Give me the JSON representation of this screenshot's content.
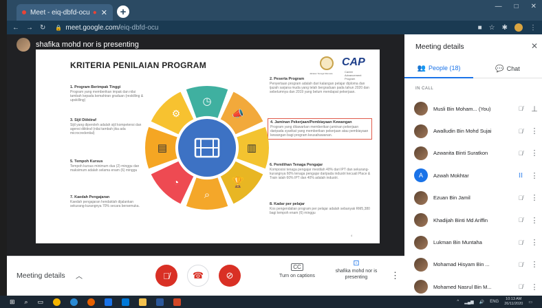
{
  "browser": {
    "tab_title": "Meet - eiq-dbfd-ocu",
    "url_host": "meet.google.com/",
    "url_path": "eiq-dbfd-ocu",
    "new_tab_icon": "+",
    "window_controls": [
      "—",
      "□",
      "✕"
    ]
  },
  "presenter": {
    "text": "shafika mohd nor is presenting"
  },
  "slide": {
    "title": "KRITERIA PENILAIAN PROGRAM",
    "logo_text": "Jabatan Tenaga Manusia",
    "logo2_text": "CAP",
    "logo2_sub": "Career Advancement Program",
    "left_items": [
      {
        "heading": "1. Program Berimpak Tinggi",
        "body": "Program yang memberikan impak dan nilai tambah kepada kemahiran graduan (reskilling & upskilling)"
      },
      {
        "heading": "3. Sijil Diiktiraf",
        "body": "Sijil yang diperoleh adalah sijil kompetensi dan agensi diiktiraf (nilai tambah jika ada microcredential)"
      },
      {
        "heading": "5. Tempoh Kursus",
        "body": "Tempoh kursus minimum dua (2) minggu dan maksimum adalah selama enam (6) minggu"
      },
      {
        "heading": "7. Kaedah Pengajaran",
        "body": "Kaedah pengajaran hendaklah dijalankan sekurang-kurangnya 70% secara bersemuka."
      }
    ],
    "right_items": [
      {
        "heading": "2. Peserta Program",
        "body": "Penyertaan program adalah dari kalangan pelajar diploma dan ijazah sarjana muda yang telah bergraduan pada tahun 2020 dan sebelumnya dan 2019 yang belum mendapat pekerjaan."
      },
      {
        "heading": "4. Jaminan Pekerjaan/Pembiayaan Kewangan",
        "body": "Program yang ditawarkan memberikan jaminan pekerjaan daripada syarikat yang memberikan pekerjaan atau pembiayaan kewangan bagi program keusahawanan."
      },
      {
        "heading": "6. Pemilihan Tenaga Pengajar",
        "body": "Komposisi tenaga pengajar mestilah 40% dari IPT dan sekurang-kurangnya 60% tenaga pengajar daripada industri kecuali Place & Train ialah 60% IPT dan 40% adalah industri."
      },
      {
        "heading": "8. Kadar per pelajar",
        "body": "Kos pengendalian program per pelajar adalah sebanyak RM5,380 bagi tempoh enam (6) minggu"
      }
    ],
    "page_number": "4",
    "wheel_colors": [
      "#3fb0a0",
      "#f2a93b",
      "#f3c330",
      "#e8b623",
      "#f4a72a",
      "#ee4a52",
      "#f5a623",
      "#f7c230"
    ]
  },
  "sidebar": {
    "title": "Meeting details",
    "close_icon": "✕",
    "tab_people": "People (18)",
    "tab_chat": "Chat",
    "in_call_label": "IN CALL",
    "participants": [
      {
        "name": "Musli Bin Moham...",
        "suffix": "(You)",
        "mic": "muted",
        "extra": "pin"
      },
      {
        "name": "Awalludin Bin Mohd Sujai",
        "mic": "muted"
      },
      {
        "name": "Azwanita Binti Suratkon",
        "mic": "muted"
      },
      {
        "name": "Azwah Mokhtar",
        "mic": "active",
        "avatar_letter": "A"
      },
      {
        "name": "Ezuan Bin Jamil",
        "mic": "muted"
      },
      {
        "name": "Khadijah Binti Md Ariffin",
        "mic": "muted"
      },
      {
        "name": "Lukman Bin Muntaha",
        "mic": "muted"
      },
      {
        "name": "Mohamad Hisyam Bin ...",
        "mic": "muted"
      },
      {
        "name": "Mohamed Nasrul Bin M...",
        "mic": "muted"
      }
    ]
  },
  "controls": {
    "meeting_details_label": "Meeting details",
    "captions_label": "Turn on captions",
    "presenting_label": "shafika mohd nor is presenting"
  },
  "taskbar": {
    "language": "ENG",
    "time": "10:13 AM",
    "date": "26/11/2020"
  }
}
